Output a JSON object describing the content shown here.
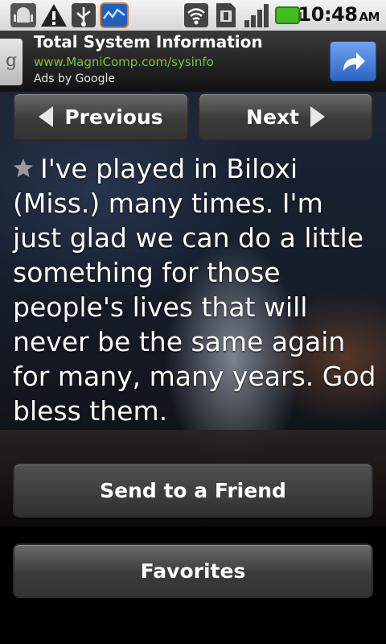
{
  "status_bar": {
    "icons": [
      "android-debug-icon",
      "warning-icon",
      "usb-icon",
      "app-notification-icon",
      "wifi-icon",
      "sim-icon",
      "signal-icon",
      "battery-icon"
    ],
    "time": "10:48",
    "ampm": "AM"
  },
  "ad": {
    "logo": "g",
    "title": "Total System Information",
    "url": "www.MagniComp.com/sysinfo",
    "attribution": "Ads by Google",
    "icon": "share-arrow-icon"
  },
  "nav": {
    "previous_label": "Previous",
    "next_label": "Next"
  },
  "quote": {
    "text": "I've played in Biloxi (Miss.) many times. I'm just glad we can do a little something for those people's lives that will never be the same again for many, many years. God bless them.",
    "icon": "star-icon"
  },
  "actions": {
    "send_label": "Send to a Friend",
    "favorites_label": "Favorites"
  },
  "colors": {
    "ad_url": "#7fc43a",
    "ad_button": "#3b73d6",
    "battery": "#3fbf1f"
  }
}
